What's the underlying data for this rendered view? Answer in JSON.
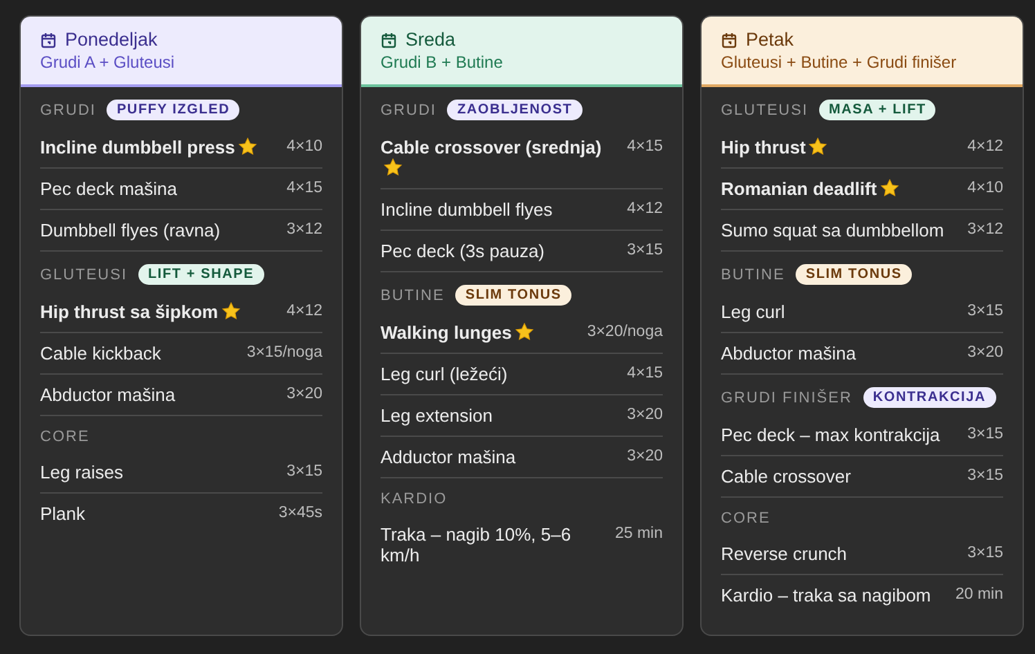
{
  "days": [
    {
      "title": "Ponedeljak",
      "subtitle": "Grudi A + Gluteusi",
      "kind": "lavender",
      "sections": [
        {
          "label": "GRUDI",
          "tag": {
            "text": "PUFFY IZGLED",
            "kind": "lavender"
          },
          "items": [
            {
              "name": "Incline dumbbell press",
              "starred": true,
              "sets": "4×10"
            },
            {
              "name": "Pec deck mašina",
              "starred": false,
              "sets": "4×15"
            },
            {
              "name": "Dumbbell flyes (ravna)",
              "starred": false,
              "sets": "3×12"
            }
          ]
        },
        {
          "label": "GLUTEUSI",
          "tag": {
            "text": "LIFT + SHAPE",
            "kind": "mint"
          },
          "items": [
            {
              "name": "Hip thrust sa šipkom",
              "starred": true,
              "sets": "4×12"
            },
            {
              "name": "Cable kickback",
              "starred": false,
              "sets": "3×15/noga"
            },
            {
              "name": "Abductor mašina",
              "starred": false,
              "sets": "3×20"
            }
          ]
        },
        {
          "label": "CORE",
          "items": [
            {
              "name": "Leg raises",
              "starred": false,
              "sets": "3×15"
            },
            {
              "name": "Plank",
              "starred": false,
              "sets": "3×45s"
            }
          ]
        }
      ]
    },
    {
      "title": "Sreda",
      "subtitle": "Grudi B + Butine",
      "kind": "mint",
      "sections": [
        {
          "label": "GRUDI",
          "tag": {
            "text": "ZAOBLJENOST",
            "kind": "lavender"
          },
          "items": [
            {
              "name": "Cable crossover (srednja)",
              "starred": true,
              "sets": "4×15"
            },
            {
              "name": "Incline dumbbell flyes",
              "starred": false,
              "sets": "4×12"
            },
            {
              "name": "Pec deck (3s pauza)",
              "starred": false,
              "sets": "3×15"
            }
          ]
        },
        {
          "label": "BUTINE",
          "tag": {
            "text": "SLIM TONUS",
            "kind": "peach"
          },
          "items": [
            {
              "name": "Walking lunges",
              "starred": true,
              "sets": "3×20/noga"
            },
            {
              "name": "Leg curl (ležeći)",
              "starred": false,
              "sets": "4×15"
            },
            {
              "name": "Leg extension",
              "starred": false,
              "sets": "3×20"
            },
            {
              "name": "Adductor mašina",
              "starred": false,
              "sets": "3×20"
            }
          ]
        },
        {
          "label": "KARDIO",
          "items": [
            {
              "name": "Traka – nagib 10%, 5–6 km/h",
              "starred": false,
              "sets": "25 min"
            }
          ]
        }
      ]
    },
    {
      "title": "Petak",
      "subtitle": "Gluteusi + Butine + Grudi finišer",
      "kind": "peach",
      "sections": [
        {
          "label": "GLUTEUSI",
          "tag": {
            "text": "MASA + LIFT",
            "kind": "mint"
          },
          "items": [
            {
              "name": "Hip thrust",
              "starred": true,
              "sets": "4×12"
            },
            {
              "name": "Romanian deadlift",
              "starred": true,
              "sets": "4×10"
            },
            {
              "name": "Sumo squat sa dumbbellom",
              "starred": false,
              "sets": "3×12"
            }
          ]
        },
        {
          "label": "BUTINE",
          "tag": {
            "text": "SLIM TONUS",
            "kind": "peach"
          },
          "items": [
            {
              "name": "Leg curl",
              "starred": false,
              "sets": "3×15"
            },
            {
              "name": "Abductor mašina",
              "starred": false,
              "sets": "3×20"
            }
          ]
        },
        {
          "label": "GRUDI FINIŠER",
          "tag": {
            "text": "KONTRAKCIJA",
            "kind": "lavender"
          },
          "items": [
            {
              "name": "Pec deck – max kontrakcija",
              "starred": false,
              "sets": "3×15"
            },
            {
              "name": "Cable crossover",
              "starred": false,
              "sets": "3×15"
            }
          ]
        },
        {
          "label": "CORE",
          "items": [
            {
              "name": "Reverse crunch",
              "starred": false,
              "sets": "3×15"
            },
            {
              "name": "Kardio – traka sa nagibom",
              "starred": false,
              "sets": "20 min"
            }
          ]
        }
      ]
    }
  ]
}
